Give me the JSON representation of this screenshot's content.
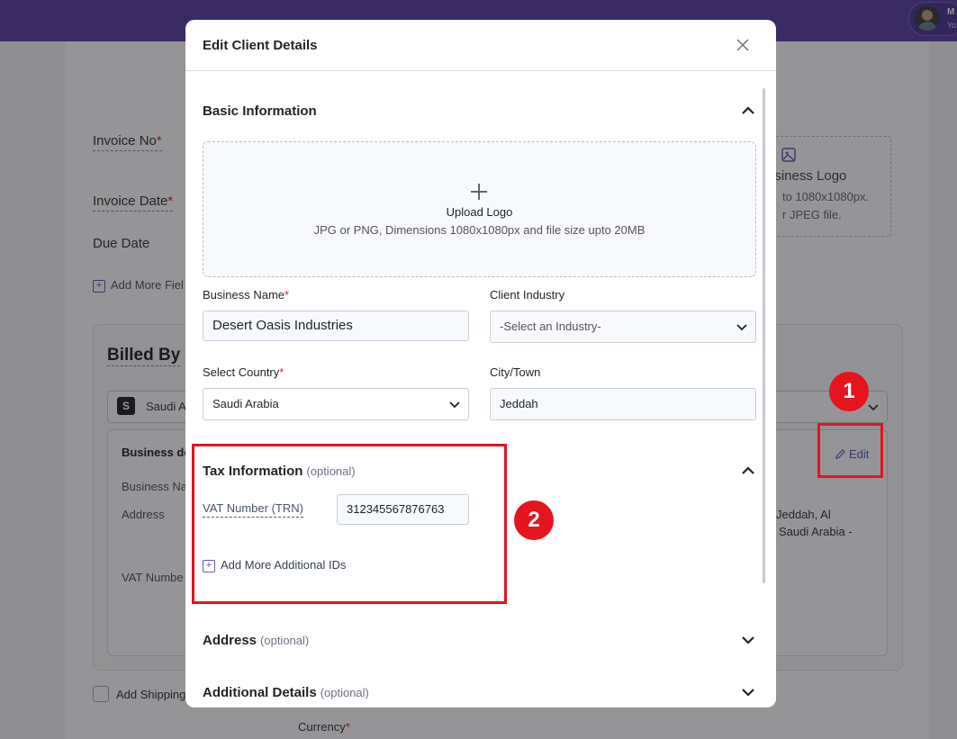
{
  "topbar": {
    "user_name": "M",
    "user_sub": "Yo"
  },
  "background": {
    "invoice_no_label": "Invoice No",
    "invoice_date_label": "Invoice Date",
    "due_date_label": "Due Date",
    "add_more_fields": "Add More Fiel",
    "logo_title": "isiness Logo",
    "logo_line1": "to 1080x1080px.",
    "logo_line2": "r JPEG file.",
    "billed_by_title": "Billed By",
    "billed_by_select": "Saudi A",
    "business_details": "Business de",
    "business_name_label": "Business Na",
    "address_label": "Address",
    "vat_number_label": "VAT Numbe",
    "address_value_1": "Jeddah, Al",
    "address_value_2": "Saudi Arabia -",
    "edit_label": "Edit",
    "add_shipping": "Add Shipping",
    "currency_label": "Currency",
    "required_mark": "*"
  },
  "modal": {
    "title": "Edit Client Details",
    "basic_section": {
      "title": "Basic Information"
    },
    "upload": {
      "title": "Upload Logo",
      "subtitle": "JPG or PNG, Dimensions 1080x1080px and file size upto 20MB"
    },
    "fields": {
      "business_name_label": "Business Name",
      "business_name_value": "Desert Oasis Industries",
      "client_industry_label": "Client Industry",
      "client_industry_value": "-Select an Industry-",
      "country_label": "Select Country",
      "country_value": "Saudi Arabia",
      "city_label": "City/Town",
      "city_value": "Jeddah",
      "required_mark": "*"
    },
    "tax_section": {
      "title": "Tax Information",
      "optional": "(optional)",
      "vat_label": "VAT Number (TRN)",
      "vat_value": "312345567876763",
      "add_more_ids": "Add More Additional IDs"
    },
    "address_section": {
      "title": "Address",
      "optional": "(optional)"
    },
    "additional_section": {
      "title": "Additional Details",
      "optional": "(optional)"
    }
  },
  "annotations": {
    "badge_1": "1",
    "badge_2": "2",
    "highlight_color": "#e5141e"
  },
  "colors": {
    "topbar": "#5b3fa3",
    "accent": "#6b4fbb",
    "required": "#e02424"
  }
}
